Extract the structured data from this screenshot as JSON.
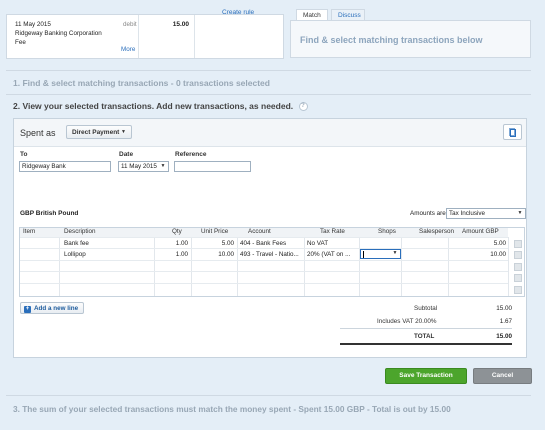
{
  "statement": {
    "date": "11 May 2015",
    "description_line1": "Ridgeway Banking Corporation",
    "description_line2": "Fee",
    "type": "debit",
    "amount": "15.00",
    "more_link": "More"
  },
  "create_rule_link": "Create rule",
  "tabs": [
    {
      "label": "Match"
    },
    {
      "label": "Discuss"
    }
  ],
  "find_panel_text": "Find & select matching transactions below",
  "steps": {
    "step1": "1. Find & select matching transactions - 0 transactions selected",
    "step2": "2. View your selected transactions. Add new transactions, as needed.",
    "step3": "3. The sum of your selected transactions must match the money spent - Spent 15.00 GBP - Total is out by 15.00"
  },
  "form": {
    "spent_as_label": "Spent as",
    "transaction_type": "Direct Payment",
    "to_label": "To",
    "to_value": "Ridgeway Bank",
    "date_label": "Date",
    "date_value": "11 May 2015",
    "reference_label": "Reference",
    "reference_value": "",
    "currency_label": "GBP British Pound",
    "amounts_are_label": "Amounts are",
    "amounts_are_value": "Tax Inclusive"
  },
  "table": {
    "headers": {
      "item": "Item",
      "description": "Description",
      "qty": "Qty",
      "unit_price": "Unit Price",
      "account": "Account",
      "tax_rate": "Tax Rate",
      "shops": "Shops",
      "salesperson": "Salesperson",
      "amount": "Amount GBP"
    },
    "rows": [
      {
        "item": "",
        "description": "Bank fee",
        "qty": "1.00",
        "unit_price": "5.00",
        "account": "404 - Bank Fees",
        "tax_rate": "No VAT",
        "shops": "",
        "salesperson": "",
        "amount": "5.00"
      },
      {
        "item": "",
        "description": "Lollipop",
        "qty": "1.00",
        "unit_price": "10.00",
        "account": "493 - Travel - Natio...",
        "tax_rate": "20% (VAT on ...",
        "shops": "",
        "salesperson": "",
        "amount": "10.00"
      }
    ]
  },
  "add_line_label": "Add a new line",
  "totals": {
    "subtotal_label": "Subtotal",
    "subtotal_value": "15.00",
    "vat_label": "Includes VAT 20.00%",
    "vat_value": "1.67",
    "total_label": "TOTAL",
    "total_value": "15.00"
  },
  "buttons": {
    "save": "Save Transaction",
    "cancel": "Cancel"
  },
  "colors": {
    "save": "#4ca52c",
    "cancel": "#8d9296",
    "accent": "#2a6ebb",
    "background": "#e4eef7"
  }
}
